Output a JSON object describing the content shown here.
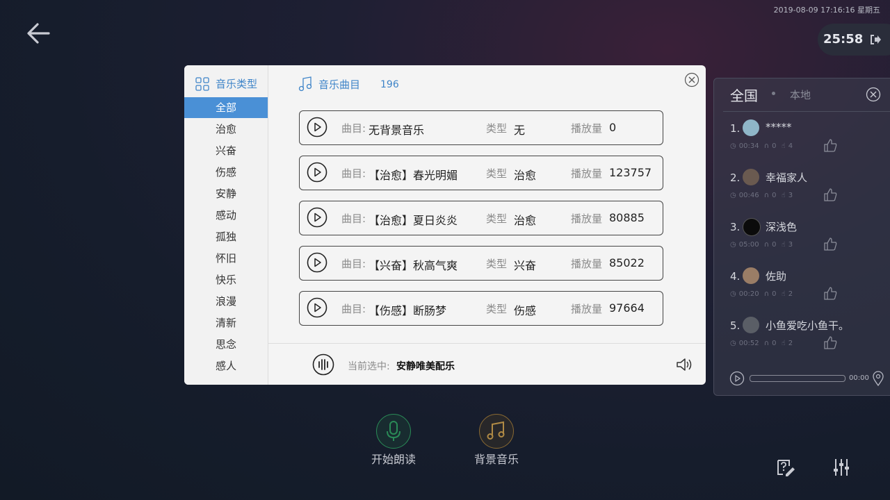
{
  "header": {
    "datetime": "2019-08-09 17:16:16 星期五",
    "timer": "25:58"
  },
  "ranking": {
    "tab_national": "全国",
    "tab_local": "本地",
    "items": [
      {
        "rank": "1.",
        "name": "*****",
        "duration": "00:34",
        "listens": "0",
        "likes": "4"
      },
      {
        "rank": "2.",
        "name": "幸福家人",
        "duration": "00:46",
        "listens": "0",
        "likes": "3"
      },
      {
        "rank": "3.",
        "name": "深浅色",
        "duration": "05:00",
        "listens": "0",
        "likes": "3"
      },
      {
        "rank": "4.",
        "name": "佐助",
        "duration": "00:20",
        "listens": "0",
        "likes": "2"
      },
      {
        "rank": "5.",
        "name": "小鱼爱吃小鱼干。",
        "duration": "00:52",
        "listens": "0",
        "likes": "2"
      }
    ],
    "player_time": "00:00"
  },
  "modal": {
    "sidebar_title": "音乐类型",
    "categories": [
      "全部",
      "治愈",
      "兴奋",
      "伤感",
      "安静",
      "感动",
      "孤独",
      "怀旧",
      "快乐",
      "浪漫",
      "清新",
      "思念",
      "感人"
    ],
    "selected_category": "全部",
    "songs_title": "音乐曲目",
    "songs_count": "196",
    "labels": {
      "song": "曲目:",
      "type": "类型",
      "plays": "播放量"
    },
    "songs": [
      {
        "title": "无背景音乐",
        "type": "无",
        "plays": "0"
      },
      {
        "title": "【治愈】春光明媚",
        "type": "治愈",
        "plays": "123757"
      },
      {
        "title": "【治愈】夏日炎炎",
        "type": "治愈",
        "plays": "80885"
      },
      {
        "title": "【兴奋】秋高气爽",
        "type": "兴奋",
        "plays": "85022"
      },
      {
        "title": "【伤感】断肠梦",
        "type": "伤感",
        "plays": "97664"
      }
    ],
    "current_label": "当前选中:",
    "current_value": "安静唯美配乐"
  },
  "actions": {
    "read_label": "开始朗读",
    "music_label": "背景音乐"
  },
  "colors": {
    "accent_blue": "#4a90d6",
    "read_green": "#2a8b57",
    "music_gold": "#b08a45"
  }
}
